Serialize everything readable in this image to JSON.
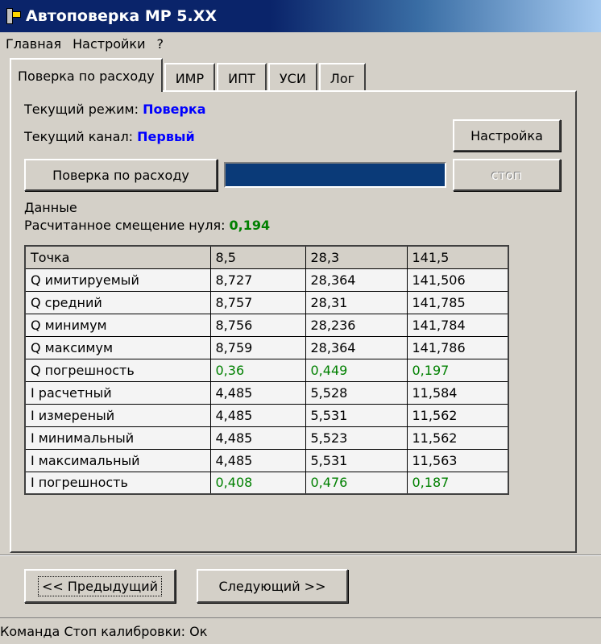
{
  "window": {
    "title": "Автоповерка МР 5.XX"
  },
  "menu": [
    "Главная",
    "Настройки",
    "?"
  ],
  "tabs": [
    "Поверка по расходу",
    "ИМР",
    "ИПТ",
    "УСИ",
    "Лог"
  ],
  "status": {
    "mode_label": "Текущий режим:",
    "mode_value": "Поверка",
    "channel_label": "Текущий канал:",
    "channel_value": "Первый"
  },
  "buttons": {
    "settings": "Настройка",
    "flow_check": "Поверка по расходу",
    "stop": "стоп",
    "prev": "<< Предыдущий",
    "next": "Следующий >>"
  },
  "progress": {
    "fraction": 1.0
  },
  "data_section": {
    "title": "Данные",
    "zero_offset_label": "Расчитанное смещение нуля:",
    "zero_offset_value": "0,194"
  },
  "table": {
    "header": [
      "Точка",
      "8,5",
      "28,3",
      "141,5"
    ],
    "rows": [
      [
        "Q имитируемый",
        "8,727",
        "28,364",
        "141,506"
      ],
      [
        "Q средний",
        "8,757",
        "28,31",
        "141,785"
      ],
      [
        "Q минимум",
        "8,756",
        "28,236",
        "141,784"
      ],
      [
        "Q максимум",
        "8,759",
        "28,364",
        "141,786"
      ],
      [
        "Q погрешность",
        "0,36",
        "0,449",
        "0,197"
      ],
      [
        "I расчетный",
        "4,485",
        "5,528",
        "11,584"
      ],
      [
        "I измереный",
        "4,485",
        "5,531",
        "11,562"
      ],
      [
        "I минимальный",
        "4,485",
        "5,523",
        "11,562"
      ],
      [
        "I максимальный",
        "4,485",
        "5,531",
        "11,563"
      ],
      [
        "I погрешность",
        "0,408",
        "0,476",
        "0,187"
      ]
    ],
    "highlight_rows": [
      4,
      9
    ],
    "highlight_color": "#008000"
  },
  "statusbar": {
    "text": "Команда Стоп калибровки: Ок"
  }
}
